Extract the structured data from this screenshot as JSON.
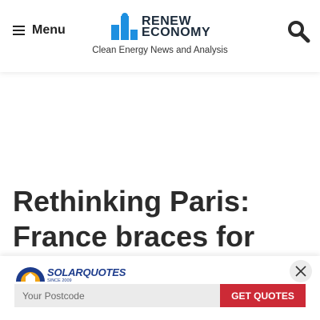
{
  "header": {
    "menu_label": "Menu",
    "brand_line1": "RENEW",
    "brand_line2": "ECONOMY",
    "tagline": "Clean Energy News and Analysis"
  },
  "article": {
    "headline_line1": "Rethinking Paris:",
    "headline_line2": "France braces for"
  },
  "ad": {
    "brand": "SOLARQUOTES",
    "since": "SINCE 2009",
    "postcode_placeholder": "Your Postcode",
    "button_label": "GET QUOTES"
  },
  "colors": {
    "brand_blue": "#1d8fe0",
    "brand_dark": "#1b2a3a",
    "cta_red": "#cc2a36",
    "solarquotes_blue": "#1d3c8c"
  },
  "icons": [
    "menu-icon",
    "search-icon",
    "close-icon",
    "renew-economy-logo",
    "solarquotes-logo"
  ]
}
